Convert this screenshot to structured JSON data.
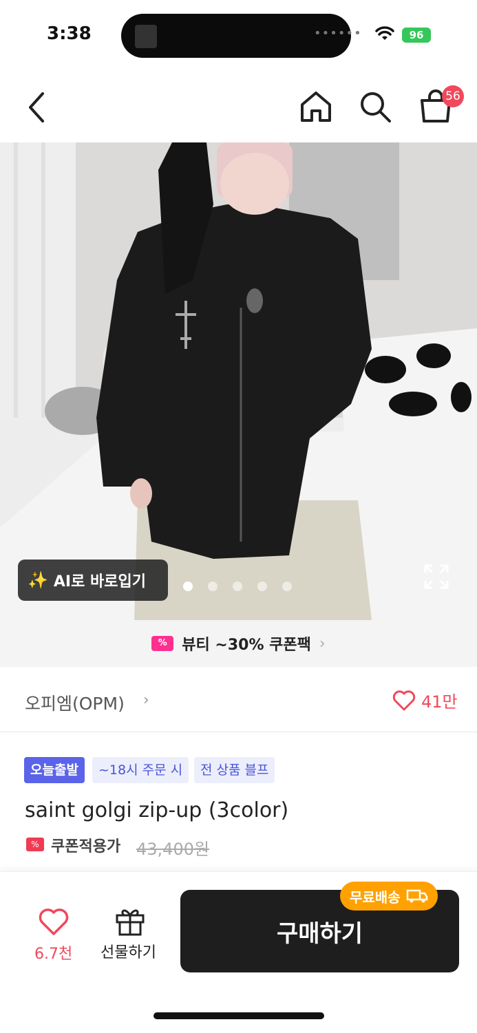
{
  "status_bar": {
    "time": "3:38",
    "battery": "96"
  },
  "header": {
    "cart_count": "56"
  },
  "hero": {
    "ai_button_label": "AI로 바로입기",
    "slide_count": 5,
    "active_slide": 0
  },
  "coupon_banner": {
    "label": "뷰티 ~30% 쿠폰팩"
  },
  "brand": {
    "name": "오피엠(OPM)",
    "likes": "41만"
  },
  "tags": {
    "today": "오늘출발",
    "time": "~18시 주문 시",
    "free": "전 상품 블프"
  },
  "product": {
    "title": "saint golgi zip-up (3color)",
    "coupon_label": "쿠폰적용가",
    "original_price": "43,400원"
  },
  "bottom_bar": {
    "wish_count": "6.7천",
    "gift_label": "선물하기",
    "buy_label": "구매하기",
    "free_shipping_label": "무료배송"
  },
  "colors": {
    "accent_red": "#f0485c",
    "tag_blue": "#5b63e9",
    "buy_button": "#1e1e1e",
    "free_ship_orange": "#ffa100"
  }
}
